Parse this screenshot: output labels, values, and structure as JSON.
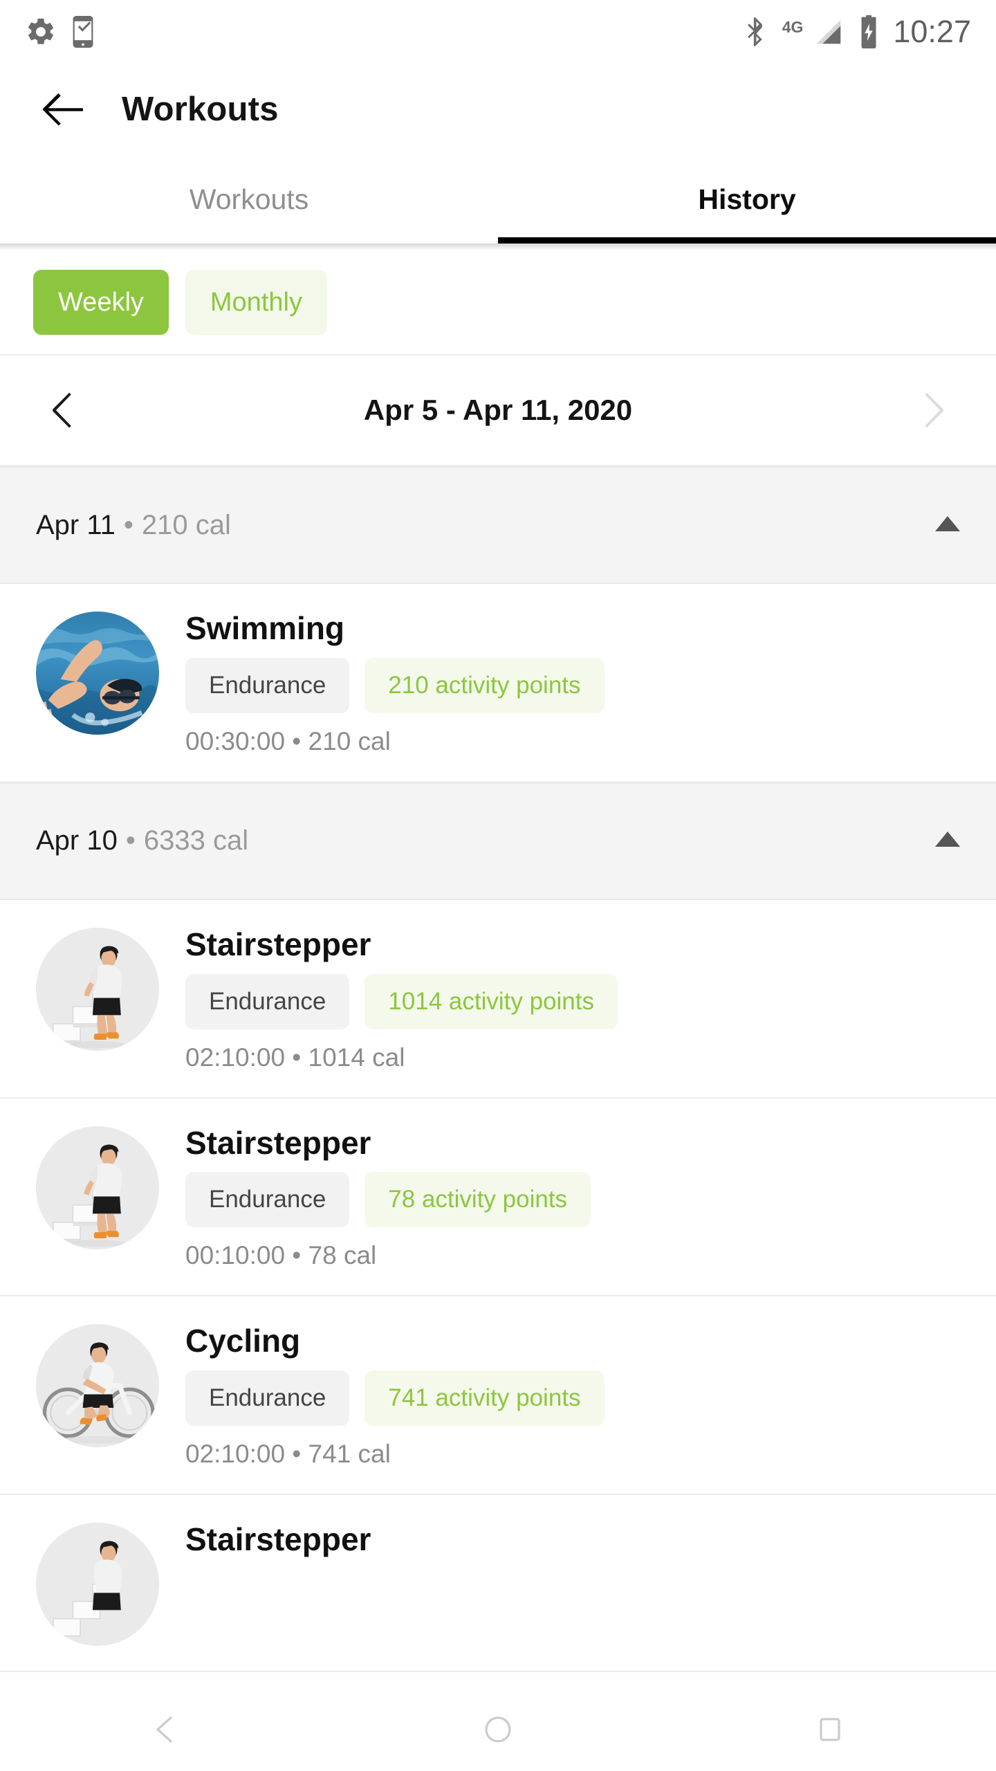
{
  "status_bar": {
    "time": "10:27",
    "network_label": "4G",
    "left_icons": [
      "settings-gear-icon",
      "phone-check-icon"
    ],
    "right_icons": [
      "bluetooth-icon",
      "signal-4g-icon",
      "battery-charging-icon"
    ]
  },
  "app_bar": {
    "back_icon": "arrow-left-icon",
    "title": "Workouts"
  },
  "tabs": [
    {
      "label": "Workouts",
      "active": false
    },
    {
      "label": "History",
      "active": true
    }
  ],
  "period_toggle": {
    "options": [
      {
        "label": "Weekly",
        "selected": true
      },
      {
        "label": "Monthly",
        "selected": false
      }
    ]
  },
  "date_nav": {
    "prev_icon": "chevron-left-icon",
    "next_icon": "chevron-right-icon",
    "range_label": "Apr 5 - Apr 11, 2020",
    "prev_enabled": true,
    "next_enabled": false
  },
  "day_groups": [
    {
      "date": "Apr 11",
      "separator": "•",
      "calories": "210 cal",
      "collapse_icon": "caret-up-icon",
      "expanded": true,
      "workouts": [
        {
          "name": "Swimming",
          "thumb": "swimming-photo",
          "type_chip": "Endurance",
          "points_chip": "210 activity points",
          "meta": "00:30:00 • 210 cal"
        }
      ]
    },
    {
      "date": "Apr 10",
      "separator": "•",
      "calories": "6333 cal",
      "collapse_icon": "caret-up-icon",
      "expanded": true,
      "workouts": [
        {
          "name": "Stairstepper",
          "thumb": "stairstepper-illustration",
          "type_chip": "Endurance",
          "points_chip": "1014 activity points",
          "meta": "02:10:00 • 1014 cal"
        },
        {
          "name": "Stairstepper",
          "thumb": "stairstepper-illustration",
          "type_chip": "Endurance",
          "points_chip": "78 activity points",
          "meta": "00:10:00 • 78 cal"
        },
        {
          "name": "Cycling",
          "thumb": "cycling-illustration",
          "type_chip": "Endurance",
          "points_chip": "741 activity points",
          "meta": "02:10:00 • 741 cal"
        },
        {
          "name": "Stairstepper",
          "thumb": "stairstepper-illustration",
          "type_chip": "",
          "points_chip": "",
          "meta": ""
        }
      ]
    }
  ],
  "nav_bar": {
    "back_icon": "nav-back-icon",
    "home_icon": "nav-home-icon",
    "recents_icon": "nav-recents-icon"
  },
  "colors": {
    "brand_green": "#8cc63e",
    "green_chip_bg": "#f4f9ec",
    "gray_chip_bg": "#f2f2f2",
    "group_header_bg": "#f4f4f4",
    "muted_text": "#8b8b8b",
    "title_text": "#111111"
  }
}
